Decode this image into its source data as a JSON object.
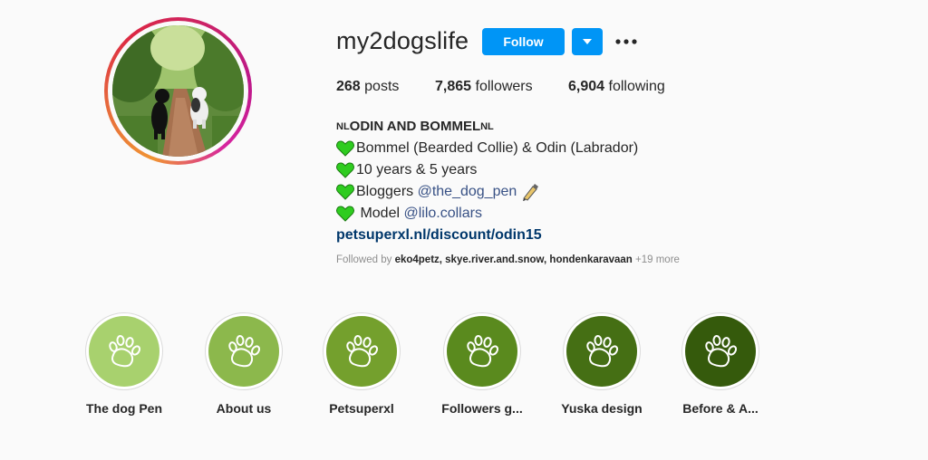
{
  "profile": {
    "username": "my2dogslife",
    "follow_label": "Follow",
    "more_icon": "ellipsis-icon",
    "dropdown_icon": "caret-down-icon"
  },
  "stats": [
    {
      "value": "268",
      "label": "posts"
    },
    {
      "value": "7,865",
      "label": "followers"
    },
    {
      "value": "6,904",
      "label": "following"
    }
  ],
  "bio": {
    "name_prefix": "NL",
    "name": "ODIN AND BOMMEL",
    "name_suffix": "NL",
    "line1": "Bommel (Bearded Collie) & Odin (Labrador)",
    "line2": "10 years & 5 years",
    "line3_text": "Bloggers ",
    "line3_mention": "@the_dog_pen",
    "line4_text": " Model ",
    "line4_mention": "@lilo.collars",
    "link": "petsuperxl.nl/discount/odin15",
    "followed_prefix": "Followed by ",
    "followed_by": "eko4petz, skye.river.and.snow, hondenkaravaan",
    "followed_more": " +19 more"
  },
  "highlights": [
    {
      "label": "The dog Pen",
      "color": "#a8d16e"
    },
    {
      "label": "About us",
      "color": "#8cb84c"
    },
    {
      "label": "Petsuperxl",
      "color": "#74a02d"
    },
    {
      "label": "Followers g...",
      "color": "#5a8a1e"
    },
    {
      "label": "Yuska design",
      "color": "#456f14"
    },
    {
      "label": "Before & A...",
      "color": "#355a0c"
    }
  ],
  "colors": {
    "accent": "#0095f6",
    "heart": "#2ecc1f",
    "mention": "#385185"
  }
}
